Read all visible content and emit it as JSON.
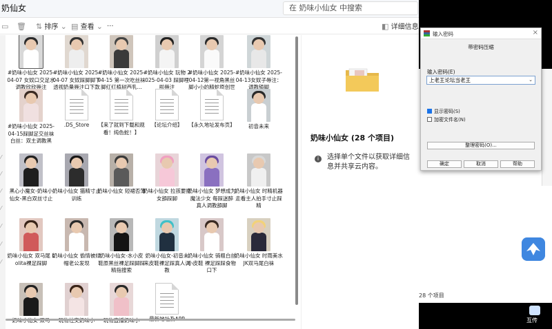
{
  "explorer": {
    "address": "奶仙女",
    "search_placeholder": "在 奶味小仙女 中搜索",
    "toolbar": {
      "sort": "排序",
      "view": "查看",
      "more": "···",
      "details": "详细信息"
    },
    "files": [
      {
        "name": "#奶味小仙女 2025-04-07 女奴口交足水调教欣欣辱注",
        "kind": "video",
        "hair": "#2b2b2b",
        "body": "#ffffff",
        "bg": "#d8d8d8"
      },
      {
        "name": "#奶味小仙女 2025-04-07 女奴踩脚脚下透视奶量辱注口下款",
        "kind": "video",
        "hair": "#333333",
        "body": "#eeeeee",
        "bg": "#e0d8d0"
      },
      {
        "name": "#奶味小仙女 2025-04-15 第一次吃丝袜脚红红植树西乳...",
        "kind": "video",
        "hair": "#444444",
        "body": "#3a3a3a",
        "bg": "#cfc5bb"
      },
      {
        "name": "#奶味小仙女 玩物 2025-04-03 踩脚哩啦辱注",
        "kind": "video",
        "hair": "#222222",
        "body": "#f4f4f4",
        "bg": "#d0d0d0"
      },
      {
        "name": "#奶味小仙女 2025-04-12第一视角黑丝脚小小的精蛇原创世界",
        "kind": "video",
        "hair": "#2a2a2a",
        "body": "#fafafa",
        "bg": "#d4d4d4"
      },
      {
        "name": "#奶味小仙女 2025-04-13女奴子辱注：调教舔脚",
        "kind": "video",
        "hair": "#333333",
        "body": "#e8e8e8",
        "bg": "#cfd6d8"
      },
      {
        "name": "#奶味小仙女 2025-04-15踩脚足交丝袜白丝：双主调教黑丝...",
        "kind": "video",
        "hair": "#3a2a22",
        "body": "#f0e0e0",
        "bg": "#e4d2cc"
      },
      {
        "name": ".DS_Store",
        "kind": "doc"
      },
      {
        "name": "【来了就到下载和观看！纯色蛇！】",
        "kind": "doc"
      },
      {
        "name": "【论坛介绍】",
        "kind": "doc"
      },
      {
        "name": "【永久地址发布页】",
        "kind": "doc"
      },
      {
        "name": "初音未来",
        "kind": "video",
        "hair": "#2a2a2a",
        "body": "#ffffff",
        "bg": "#c9cfd2"
      },
      {
        "name": "黑心小魔女-奶味小仙女-黑白双丝寸止",
        "kind": "video",
        "hair": "#222222",
        "body": "#1e1e1e",
        "bg": "#c0c0c8"
      },
      {
        "name": "奶味小仙女 猫精寸止训练",
        "kind": "video",
        "hair": "#181818",
        "body": "#2c2c2c",
        "bg": "#a8a8b0"
      },
      {
        "name": "奶味小仙女 短裙否薄",
        "kind": "video",
        "hair": "#3b3b3b",
        "body": "#5a5a5a",
        "bg": "#b8b0a8"
      },
      {
        "name": "奶味小仙女 拉孩要把女舔踩脚",
        "kind": "video",
        "hair": "#f0a0c0",
        "body": "#f6c8d8",
        "bg": "#e8d4d8"
      },
      {
        "name": "奶味小仙女 梦想成为魔法少女 每踩迷醉 真人调教舔脚",
        "kind": "video",
        "hair": "#6a4ca0",
        "body": "#8a70c0",
        "bg": "#d0c4e0"
      },
      {
        "name": "奶味小仙女 时精机器走看主人拍手寸止踩精",
        "kind": "video",
        "hair": "#d8d8d8",
        "body": "#f0f0f0",
        "bg": "#c8c8c8"
      },
      {
        "name": "奶味小仙女 双马尾 Lolita裸足踩脚",
        "kind": "video",
        "hair": "#3a2418",
        "body": "#d05a5a",
        "bg": "#e2c8c0"
      },
      {
        "name": "奶味小仙女 偷情被绿帽老公发现",
        "kind": "video",
        "hair": "#2a2a2a",
        "body": "#ffffff",
        "bg": "#c8b8b0"
      },
      {
        "name": "奶味小仙女-水小皮鞋原黑丝裸足踩脚踩精指搜索",
        "kind": "video",
        "hair": "#2a2a2a",
        "body": "#141414",
        "bg": "#b8b8b8"
      },
      {
        "name": "奶味小仙女-初音未来皮鞋裸足踩真人调教",
        "kind": "video",
        "hair": "#40c0c8",
        "body": "#203040",
        "bg": "#c0d8e0"
      },
      {
        "name": "奶味小仙女 骑粗白丝 小皮鞋 裸足踩踩食物口下",
        "kind": "video",
        "hair": "#3a2a22",
        "body": "#ffffff",
        "bg": "#d8c8c8"
      },
      {
        "name": "奶味小仙女 时雨美水JK双马尾白袜",
        "kind": "video",
        "hair": "#f2d27a",
        "body": "#2a2a3a",
        "bg": "#d8d0c0"
      },
      {
        "name": "奶味小仙女 双马",
        "kind": "video",
        "hair": "#222222",
        "body": "#1a1a1a",
        "bg": "#c8c0b8"
      },
      {
        "name": "玩物社交奶味小",
        "kind": "video",
        "hair": "#3a2418",
        "body": "#f4e4e4",
        "bg": "#e0d0d0"
      },
      {
        "name": "玩物直播奶味小",
        "kind": "video",
        "hair": "#2a2a2a",
        "body": "#f0c0c8",
        "bg": "#e8d8d8"
      },
      {
        "name": "最新地址及APP",
        "kind": "doc"
      }
    ]
  },
  "details": {
    "folder_title": "奶味小仙女 (28 个项目)",
    "info": "选择单个文件以获取详细信息并共享云内容。"
  },
  "dialog": {
    "title": "输入密码",
    "heading": "带密码压缩",
    "password_label": "输入密码(E)",
    "password_value": "上老王论坛当老王",
    "show_password": "显示密码(S)",
    "encrypt_names": "加密文件名(N)",
    "organize": "整理密码(O)...",
    "ok": "确定",
    "cancel": "取消",
    "help": "帮助"
  },
  "background": {
    "item_count": "28 个项目"
  },
  "desktop": {
    "app_label": "互传"
  }
}
